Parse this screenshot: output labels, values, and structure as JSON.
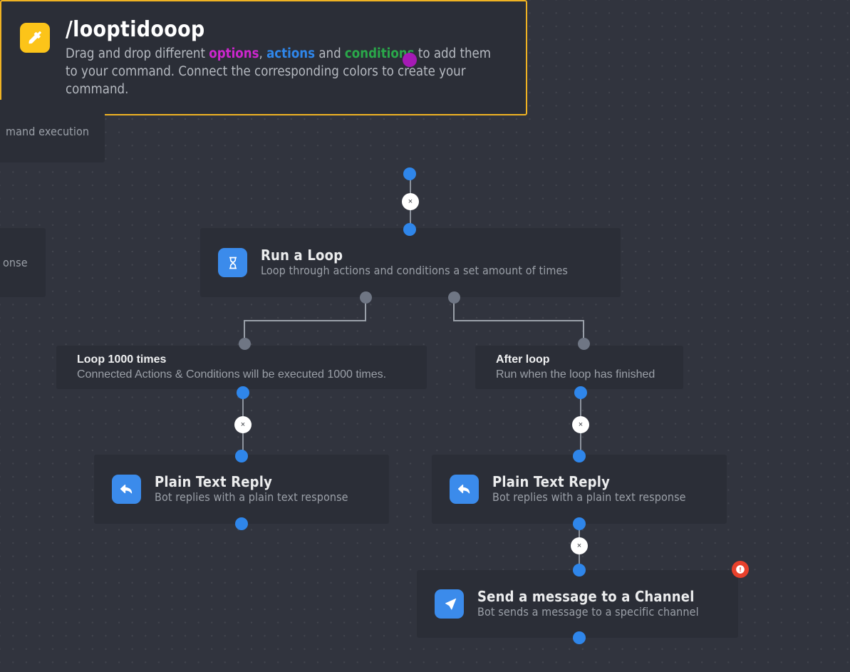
{
  "canvas": {
    "background_color": "#31343e",
    "card_color": "#2b2e37",
    "grid": "dot-grid"
  },
  "command_card": {
    "title": "/looptidooop",
    "icon": "hammer-icon",
    "accent_color": "#f0b323",
    "icon_bg": "#fcc419",
    "description_parts": {
      "p1": "Drag and drop different ",
      "options": "options",
      "p2": ", ",
      "actions": "actions",
      "p3": " and ",
      "conditions": "conditions",
      "p4": " to add them to your command. Connect the corresponding colors to create your command."
    },
    "keyword_colors": {
      "options": "#cd26cd",
      "actions": "#2f86ea",
      "conditions": "#2aa84a"
    }
  },
  "nodes": {
    "loop": {
      "title": "Run a Loop",
      "subtitle": "Loop through actions and conditions a set amount of times",
      "icon": "hourglass-icon",
      "icon_bg": "#3b8beb"
    },
    "reply_left": {
      "title": "Plain Text Reply",
      "subtitle": "Bot replies with a plain text response",
      "icon": "reply-arrow-icon",
      "icon_bg": "#3b8beb"
    },
    "reply_right": {
      "title": "Plain Text Reply",
      "subtitle": "Bot replies with a plain text response",
      "icon": "reply-arrow-icon",
      "icon_bg": "#3b8beb"
    },
    "send_channel": {
      "title": "Send a message to a Channel",
      "subtitle": "Bot sends a message to a specific channel",
      "icon": "paper-plane-icon",
      "icon_bg": "#3b8beb"
    }
  },
  "branches": {
    "loop_branch": {
      "title": "Loop 1000 times",
      "subtitle": "Connected Actions & Conditions will be executed 1000 times."
    },
    "after_branch": {
      "title": "After loop",
      "subtitle": "Run when the loop has finished"
    }
  },
  "partial_nodes": {
    "top": "mand execution",
    "bottom": "onse"
  },
  "connectors": {
    "remove_label": "×",
    "dot_colors": {
      "input": "#2f86ea",
      "option": "#a51ab5",
      "branch": "#6f7684"
    }
  },
  "status": {
    "error_badge": "error-exclamation",
    "error_color": "#e8412c"
  }
}
